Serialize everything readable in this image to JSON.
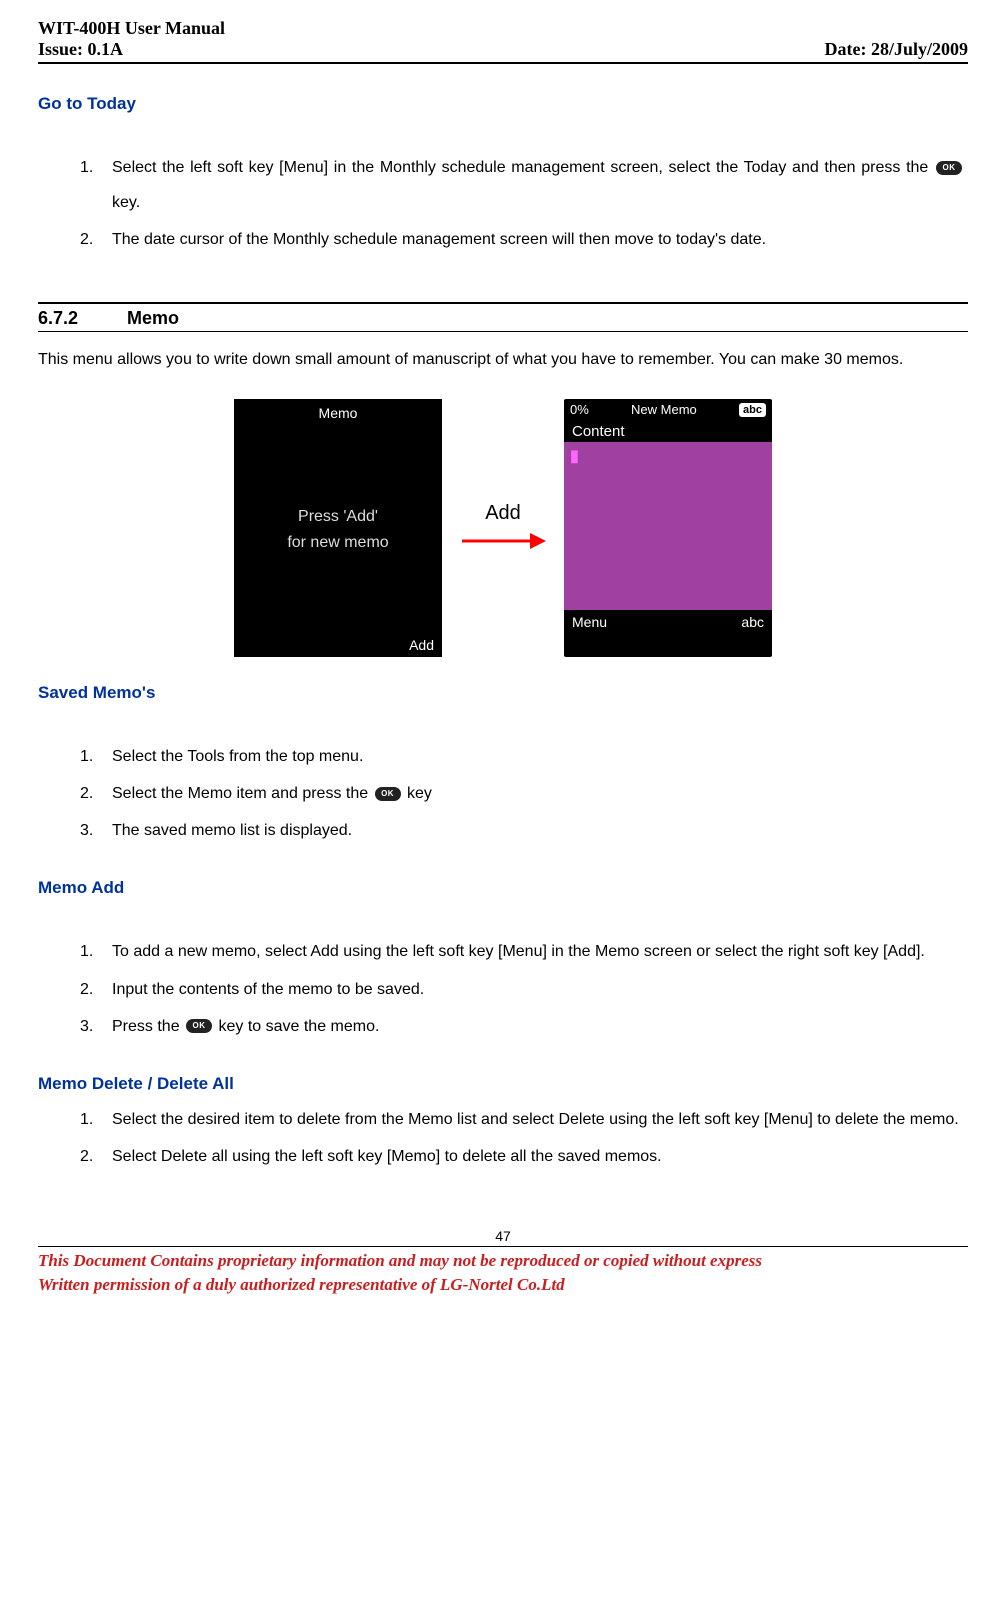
{
  "header": {
    "left_title": "WIT-400H User Manual",
    "left_issue": "Issue: 0.1A",
    "right_date": "Date: 28/July/2009"
  },
  "go_today": {
    "title": "Go to Today",
    "items": [
      "Select the left soft key [Menu] in the Monthly schedule management screen, select the Today and then press the ",
      "The date cursor of the Monthly schedule management screen will then move to today's date."
    ],
    "key_suffix": " key."
  },
  "section": {
    "num": "6.7.2",
    "title": "Memo",
    "intro": "This menu allows you to write down small amount of manuscript of what you have to remember. You can make 30 memos."
  },
  "figure": {
    "phone1": {
      "title": "Memo",
      "hint_line1": "Press 'Add'",
      "hint_line2": "for new memo",
      "soft_left": "",
      "soft_right": "Add"
    },
    "arrow_label": "Add",
    "phone2": {
      "percent": "0%",
      "title": "New Memo",
      "abc_badge": "abc",
      "content_label": "Content",
      "soft_left": "Menu",
      "soft_right": "abc"
    }
  },
  "saved": {
    "title": "Saved Memo's",
    "items": [
      "Select the Tools from the top menu.",
      "Select the Memo item and press the ",
      "The saved memo list is displayed."
    ],
    "key_suffix": " key"
  },
  "memo_add": {
    "title": "Memo Add",
    "items": [
      "To add a new memo, select Add using the left soft key [Menu] in the Memo screen or select the right soft key [Add].",
      "Input the contents of the memo to be saved.",
      "Press the "
    ],
    "key_suffix": " key to save the memo."
  },
  "memo_delete": {
    "title": "Memo Delete / Delete All",
    "items": [
      "Select the desired item to delete from the Memo list and select Delete using the left soft key [Menu] to delete the memo.",
      "Select Delete all using the left soft key [Memo] to delete all the saved memos."
    ]
  },
  "footer": {
    "page_number": "47",
    "line1": "This Document Contains proprietary information and may not be reproduced or copied without express",
    "line2": "Written permission of a duly authorized representative of LG-Nortel Co.Ltd"
  }
}
